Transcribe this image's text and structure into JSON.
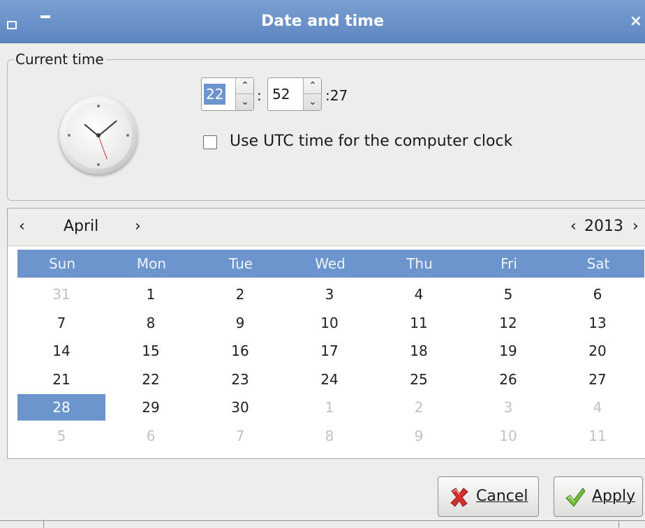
{
  "window": {
    "title": "Date and time",
    "close_glyph": "×",
    "menu_icon": "window-menu-icon",
    "minimize_icon": "minimize-icon"
  },
  "current_time": {
    "group_label": "Current time",
    "hour": "22",
    "minute": "52",
    "second": ":27",
    "colon": ":",
    "spin_up": "⌃",
    "spin_down": "⌄",
    "utc_label": "Use UTC time for the computer clock",
    "utc_checked": false
  },
  "calendar": {
    "month": "April",
    "year": "2013",
    "prev_month": "‹",
    "next_month": "›",
    "prev_year": "‹",
    "next_year": "›",
    "day_names": [
      "Sun",
      "Mon",
      "Tue",
      "Wed",
      "Thu",
      "Fri",
      "Sat"
    ],
    "weeks": [
      [
        {
          "d": "31",
          "m": true
        },
        {
          "d": "1"
        },
        {
          "d": "2"
        },
        {
          "d": "3"
        },
        {
          "d": "4"
        },
        {
          "d": "5"
        },
        {
          "d": "6"
        }
      ],
      [
        {
          "d": "7"
        },
        {
          "d": "8"
        },
        {
          "d": "9"
        },
        {
          "d": "10"
        },
        {
          "d": "11"
        },
        {
          "d": "12"
        },
        {
          "d": "13"
        }
      ],
      [
        {
          "d": "14"
        },
        {
          "d": "15"
        },
        {
          "d": "16"
        },
        {
          "d": "17"
        },
        {
          "d": "18"
        },
        {
          "d": "19"
        },
        {
          "d": "20"
        }
      ],
      [
        {
          "d": "21"
        },
        {
          "d": "22"
        },
        {
          "d": "23"
        },
        {
          "d": "24"
        },
        {
          "d": "25"
        },
        {
          "d": "26"
        },
        {
          "d": "27"
        }
      ],
      [
        {
          "d": "28",
          "s": true
        },
        {
          "d": "29"
        },
        {
          "d": "30"
        },
        {
          "d": "1",
          "m": true
        },
        {
          "d": "2",
          "m": true
        },
        {
          "d": "3",
          "m": true
        },
        {
          "d": "4",
          "m": true
        }
      ],
      [
        {
          "d": "5",
          "m": true
        },
        {
          "d": "6",
          "m": true
        },
        {
          "d": "7",
          "m": true
        },
        {
          "d": "8",
          "m": true
        },
        {
          "d": "9",
          "m": true
        },
        {
          "d": "10",
          "m": true
        },
        {
          "d": "11",
          "m": true
        }
      ]
    ],
    "selected_day": "28",
    "accent_color": "#6d95cd"
  },
  "buttons": {
    "cancel_label": "Cancel",
    "cancel_icon": "red-x-icon",
    "apply_label": "Apply",
    "apply_icon": "green-check-icon"
  }
}
